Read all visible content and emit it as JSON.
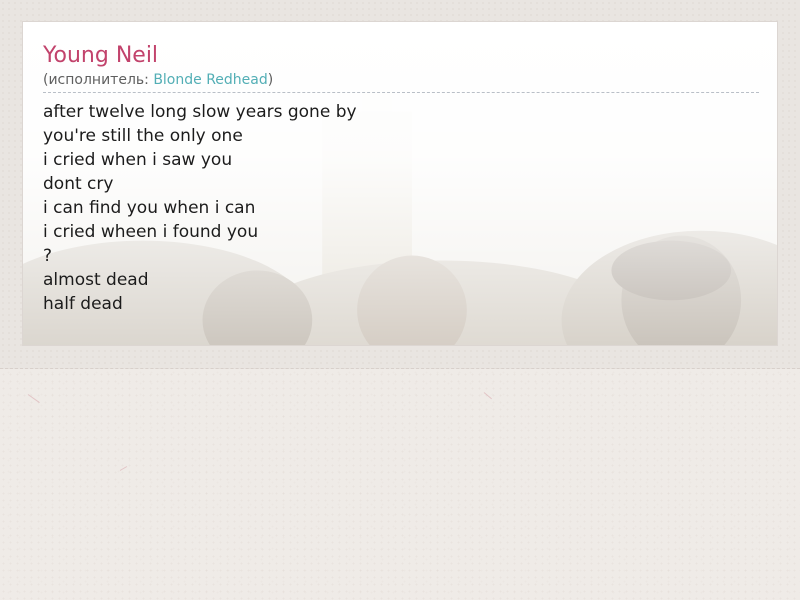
{
  "song": {
    "title": "Young Neil",
    "artist_prefix": "(исполнитель: ",
    "artist_name": "Blonde Redhead",
    "artist_suffix": ")"
  },
  "lyrics": [
    "after twelve long slow years gone by",
    "you're still the only one",
    "i cried when i saw you",
    "dont cry",
    "i can find you when i can",
    "i cried wheen i found you",
    "?",
    "almost dead",
    "half dead"
  ],
  "colors": {
    "title": "#c2436c",
    "link": "#52aeb5",
    "text": "#1c1c1c",
    "background": "#efebe7"
  },
  "icons": {
    "background_photo": "band-photo-silhouettes"
  }
}
